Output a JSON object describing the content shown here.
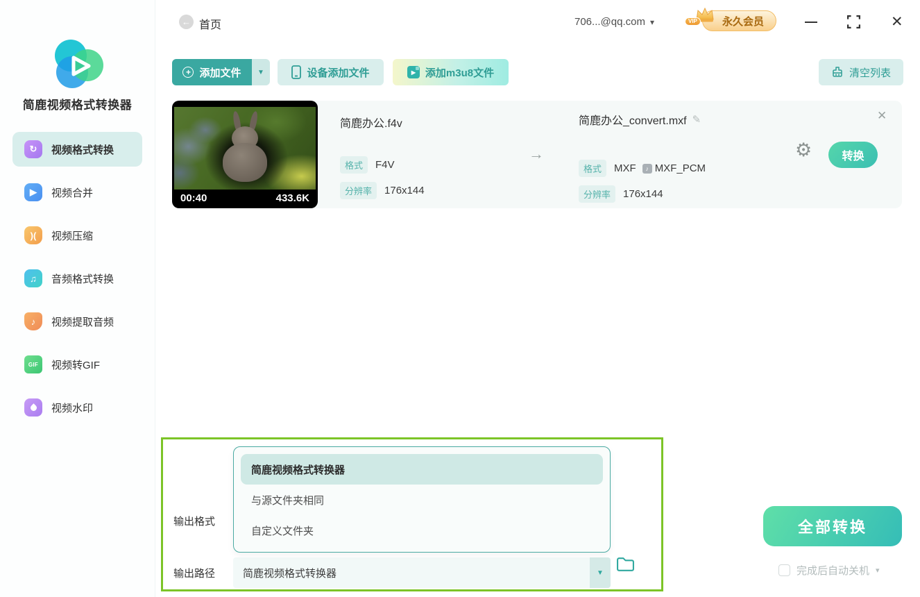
{
  "app": {
    "title": "简鹿视频格式转换器"
  },
  "titlebar": {
    "home": "首页",
    "account": "706...@qq.com",
    "vip": "永久会员",
    "vip_tag": "VIP"
  },
  "sidebar": {
    "items": [
      {
        "label": "视频格式转换",
        "active": true
      },
      {
        "label": "视频合并",
        "active": false
      },
      {
        "label": "视频压缩",
        "active": false
      },
      {
        "label": "音频格式转换",
        "active": false
      },
      {
        "label": "视频提取音频",
        "active": false
      },
      {
        "label": "视频转GIF",
        "active": false
      },
      {
        "label": "视频水印",
        "active": false
      }
    ]
  },
  "toolbar": {
    "add_file": "添加文件",
    "device_add": "设备添加文件",
    "add_m3u8": "添加m3u8文件",
    "clear_list": "清空列表"
  },
  "file_item": {
    "duration": "00:40",
    "size": "433.6K",
    "source_name": "简鹿办公.f4v",
    "format_label": "格式",
    "source_format": "F4V",
    "resolution_label": "分辨率",
    "source_resolution": "176x144",
    "target_name": "简鹿办公_convert.mxf",
    "target_format": "MXF",
    "target_codec": "MXF_PCM",
    "target_resolution": "176x144",
    "convert": "转换"
  },
  "output": {
    "format_label": "输出格式",
    "path_label": "输出路径",
    "options": [
      "简鹿视频格式转换器",
      "与源文件夹相同",
      "自定义文件夹"
    ],
    "selected_option": "简鹿视频格式转换器",
    "path_value": "简鹿视频格式转换器"
  },
  "footer": {
    "convert_all": "全部转换",
    "shutdown": "完成后自动关机"
  },
  "icons": {
    "back": "←",
    "caret_down": "▼",
    "caret_small": "▾",
    "plus": "+",
    "play": "▶",
    "sync": "↻",
    "compress": ")(",
    "note": "♪",
    "beamed_note": "♫",
    "gif": "GIF",
    "arrow_right": "→",
    "edit": "✎",
    "gear": "⚙",
    "close": "✕",
    "codec_note": "♪"
  },
  "colors": {
    "accent": "#38a7a0",
    "accent_light": "#d8eeec",
    "annotation_green": "#7cc427",
    "vip_gold": "#f3bd66",
    "convert_gradient_start": "#5fdfa8",
    "convert_gradient_end": "#35bdb7"
  }
}
